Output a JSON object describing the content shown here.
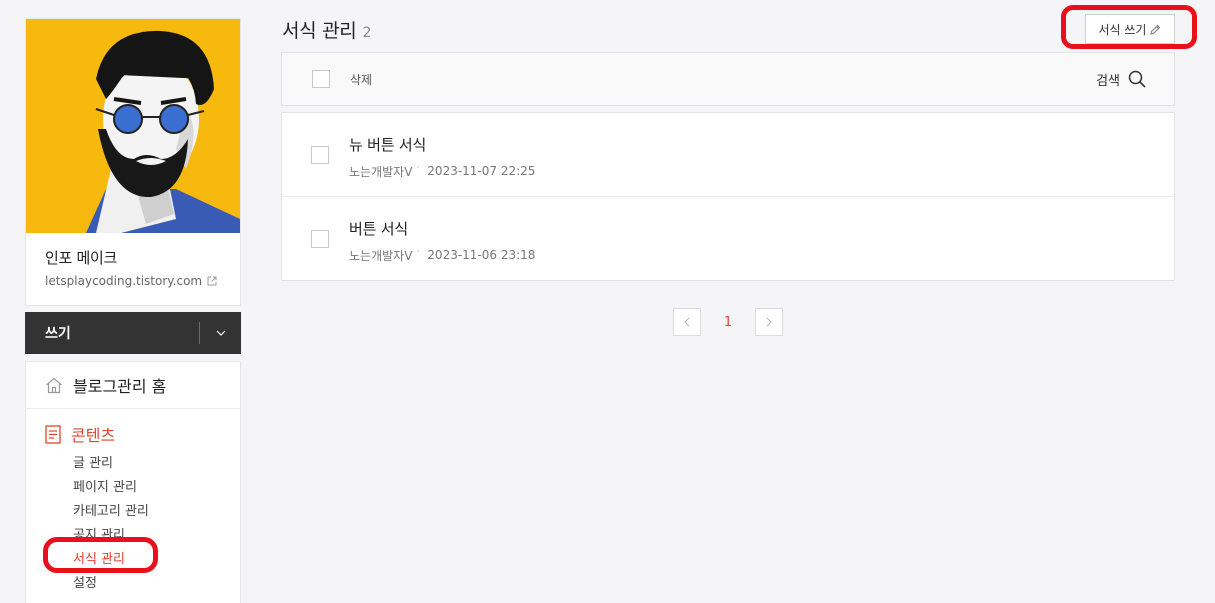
{
  "profile": {
    "blog_name": "인포 메이크",
    "blog_url": "letsplaycoding.tistory.com"
  },
  "write_button": {
    "label": "쓰기"
  },
  "menu": {
    "home_label": "블로그관리 홈",
    "section_title": "콘텐츠",
    "items": [
      {
        "label": "글 관리"
      },
      {
        "label": "페이지 관리"
      },
      {
        "label": "카테고리 관리"
      },
      {
        "label": "공지 관리"
      },
      {
        "label": "서식 관리",
        "active": true
      },
      {
        "label": "설정"
      }
    ]
  },
  "page": {
    "title": "서식 관리",
    "count": "2",
    "new_button_label": "서식 쓰기"
  },
  "toolbar": {
    "delete_label": "삭제",
    "search_label": "검색"
  },
  "items": [
    {
      "title": "뉴 버튼 서식",
      "author": "노는개발자V",
      "date": "2023-11-07 22:25"
    },
    {
      "title": "버튼 서식",
      "author": "노는개발자V",
      "date": "2023-11-06 23:18"
    }
  ],
  "pagination": {
    "current": "1"
  },
  "colors": {
    "accent": "#e24331",
    "annotation": "#e8101c",
    "dark_button": "#333333",
    "avatar_background": "#f7b90e"
  },
  "icons": [
    "home-icon",
    "document-icon",
    "pencil-icon",
    "search-icon",
    "chevron-down-icon",
    "external-link-icon",
    "chevron-left-icon",
    "chevron-right-icon"
  ]
}
